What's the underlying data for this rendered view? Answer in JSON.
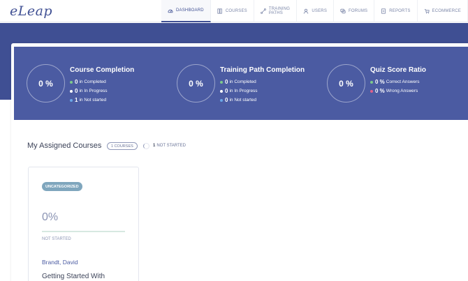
{
  "app": {
    "logo_text": "eLeap"
  },
  "nav": [
    {
      "label": "DASHBOARD",
      "icon": "dashboard-icon",
      "active": true
    },
    {
      "label": "COURSES",
      "icon": "courses-icon",
      "active": false
    },
    {
      "label": "TRAINING PATHS",
      "icon": "training-paths-icon",
      "active": false
    },
    {
      "label": "USERS",
      "icon": "users-icon",
      "active": false
    },
    {
      "label": "FORUMS",
      "icon": "forums-icon",
      "active": false
    },
    {
      "label": "REPORTS",
      "icon": "reports-icon",
      "active": false
    },
    {
      "label": "ECOMMERCE",
      "icon": "ecommerce-icon",
      "active": false
    }
  ],
  "stats": {
    "course_completion": {
      "value": "0 %",
      "title": "Course Completion",
      "rows": [
        {
          "value": "0",
          "label": "in Completed",
          "color": "#7dc98a"
        },
        {
          "value": "0",
          "label": "in In Progress",
          "color": "#ffffff"
        },
        {
          "value": "1",
          "label": "in Not started",
          "color": "#6aa8e8"
        }
      ]
    },
    "training_path_completion": {
      "value": "0 %",
      "title": "Training Path Completion",
      "rows": [
        {
          "value": "0",
          "label": "in Completed",
          "color": "#7dc98a"
        },
        {
          "value": "0",
          "label": "in In Progress",
          "color": "#ffffff"
        },
        {
          "value": "0",
          "label": "in Not started",
          "color": "#6aa8e8"
        }
      ]
    },
    "quiz_score_ratio": {
      "value": "0 %",
      "title": "Quiz Score Ratio",
      "rows": [
        {
          "value": "0 %",
          "label": "Correct Answers",
          "color": "#7dc98a"
        },
        {
          "value": "0 %",
          "label": "Wrong Answers",
          "color": "#e0608a"
        }
      ]
    }
  },
  "assigned": {
    "title": "My Assigned Courses",
    "count_pill": "1 COURSES",
    "not_started_count": "1",
    "not_started_label": "NOT STARTED"
  },
  "course_card": {
    "category": "UNCATEGORIZED",
    "percent": "0%",
    "progress_fraction": 0,
    "status": "NOT STARTED",
    "author": "Brandt, David",
    "title": "Getting Started With"
  },
  "colors": {
    "brand": "#3f4f93",
    "stats_panel": "#4b5ba2",
    "category_tag": "#7fa6bd"
  }
}
